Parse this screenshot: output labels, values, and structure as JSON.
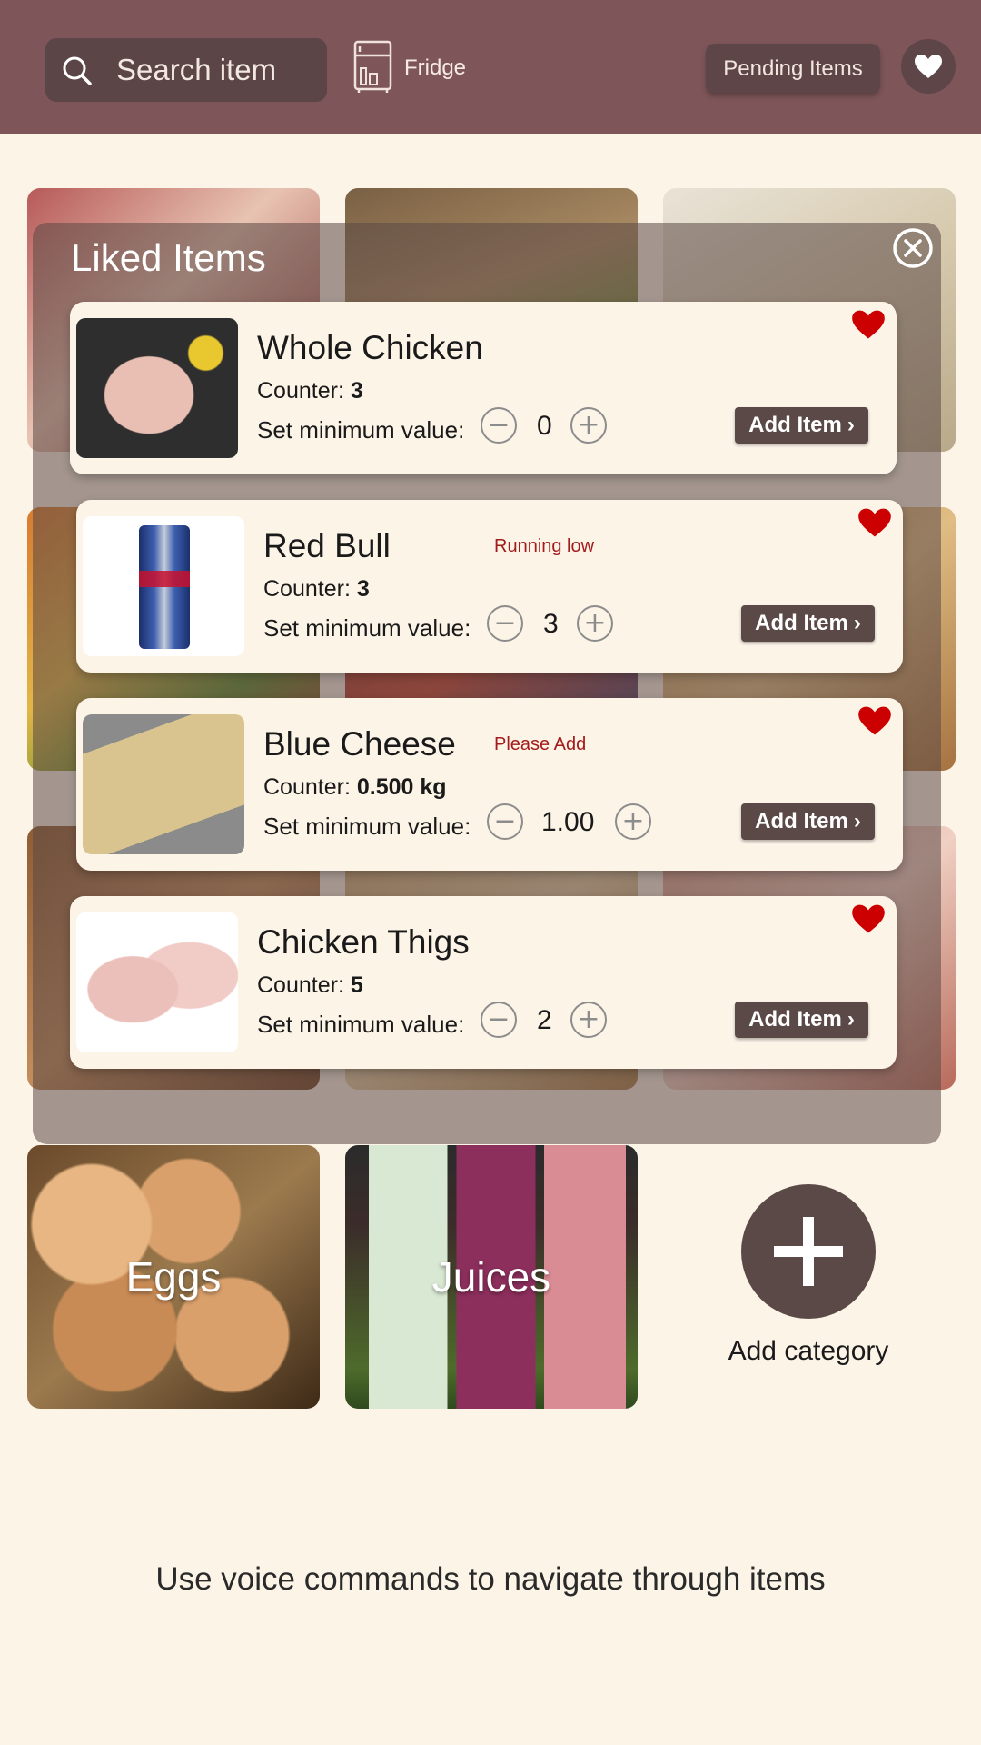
{
  "header": {
    "search_placeholder": "Search item",
    "fridge_label": "Fridge",
    "pending_label": "Pending Items"
  },
  "categories": [
    {
      "label": ""
    },
    {
      "label": ""
    },
    {
      "label": ""
    },
    {
      "label": ""
    },
    {
      "label": ""
    },
    {
      "label": ""
    },
    {
      "label": ""
    },
    {
      "label": ""
    },
    {
      "label": ""
    },
    {
      "label": "Eggs"
    },
    {
      "label": "Juices"
    }
  ],
  "overlay": {
    "title": "Liked Items"
  },
  "items": [
    {
      "name": "Whole Chicken",
      "counter_label": "Counter:",
      "counter_value": "3",
      "status": "",
      "min_label": "Set minimum value:",
      "min_value": "0",
      "add_label": "Add Item"
    },
    {
      "name": "Red Bull",
      "counter_label": "Counter:",
      "counter_value": "3",
      "status": "Running low",
      "min_label": "Set minimum value:",
      "min_value": "3",
      "add_label": "Add Item"
    },
    {
      "name": "Blue Cheese",
      "counter_label": "Counter:",
      "counter_value": "0.500 kg",
      "status": "Please Add",
      "min_label": "Set minimum value:",
      "min_value": "1.00",
      "add_label": "Add Item"
    },
    {
      "name": "Chicken Thigs",
      "counter_label": "Counter:",
      "counter_value": "5",
      "status": "",
      "min_label": "Set minimum value:",
      "min_value": "2",
      "add_label": "Add Item"
    }
  ],
  "add_category_label": "Add category",
  "voice_hint": "Use voice commands to navigate through items",
  "icons": {
    "search": "search-icon",
    "fridge": "fridge-icon",
    "favorites": "heart-icon",
    "close": "close-icon",
    "liked": "heart-icon",
    "minus": "minus-icon",
    "plus": "plus-icon",
    "chevron": "chevron-right-icon",
    "add": "plus-icon"
  },
  "colors": {
    "header_bg": "#7e5659",
    "page_bg": "#fdf4e8",
    "button_dark": "#5a4947",
    "heart": "#cc0000",
    "status_red": "#a31b1b"
  }
}
